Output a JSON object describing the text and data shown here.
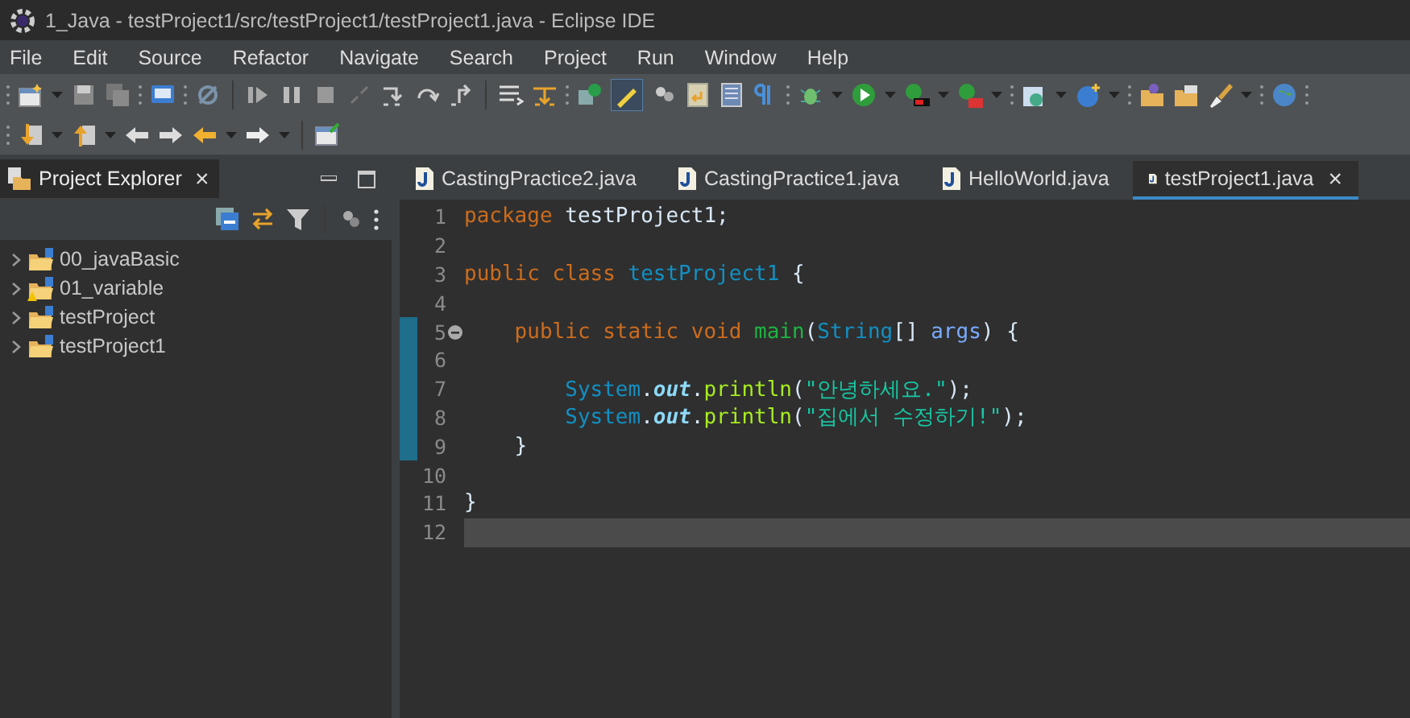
{
  "window": {
    "title": "1_Java - testProject1/src/testProject1/testProject1.java - Eclipse IDE"
  },
  "menu": [
    "File",
    "Edit",
    "Source",
    "Refactor",
    "Navigate",
    "Search",
    "Project",
    "Run",
    "Window",
    "Help"
  ],
  "explorer": {
    "title": "Project Explorer",
    "close": "×",
    "items": [
      {
        "name": "00_javaBasic",
        "expanded": false,
        "warning": false
      },
      {
        "name": "01_variable",
        "expanded": false,
        "warning": true
      },
      {
        "name": "testProject",
        "expanded": false,
        "warning": false
      },
      {
        "name": "testProject1",
        "expanded": false,
        "warning": false
      }
    ]
  },
  "editor": {
    "tabs": [
      {
        "label": "CastingPractice2.java",
        "selected": false
      },
      {
        "label": "CastingPractice1.java",
        "selected": false
      },
      {
        "label": "HelloWorld.java",
        "selected": false
      },
      {
        "label": "testProject1.java",
        "selected": true,
        "close": "×"
      }
    ],
    "lines": [
      {
        "number": "1",
        "changed": false,
        "foldable": false,
        "current": false,
        "tokens": [
          {
            "kind": "keyword",
            "text": "package "
          },
          {
            "kind": "plain",
            "text": "testProject1;"
          }
        ]
      },
      {
        "number": "2",
        "changed": false,
        "foldable": false,
        "current": false
      },
      {
        "number": "3",
        "changed": false,
        "foldable": false,
        "current": false,
        "tokens": [
          {
            "kind": "keyword",
            "text": "public class "
          },
          {
            "kind": "type",
            "text": "testProject1"
          },
          {
            "kind": "plain",
            "text": " {"
          }
        ]
      },
      {
        "number": "4",
        "changed": false,
        "foldable": false,
        "current": false
      },
      {
        "number": "5",
        "changed": true,
        "foldable": true,
        "current": false,
        "tokens": [
          {
            "kind": "keyword",
            "text": "    public static void "
          },
          {
            "kind": "method",
            "text": "main"
          },
          {
            "kind": "plain",
            "text": "("
          },
          {
            "kind": "type",
            "text": "String"
          },
          {
            "kind": "plain",
            "text": "[] "
          },
          {
            "kind": "param",
            "text": "args"
          },
          {
            "kind": "plain",
            "text": ") {"
          }
        ]
      },
      {
        "number": "6",
        "changed": true,
        "foldable": false,
        "current": false
      },
      {
        "number": "7",
        "changed": true,
        "foldable": false,
        "current": false,
        "tokens": [
          {
            "kind": "type",
            "text": "        System"
          },
          {
            "kind": "plain",
            "text": "."
          },
          {
            "kind": "field",
            "text": "out"
          },
          {
            "kind": "plain",
            "text": "."
          },
          {
            "kind": "call",
            "text": "println"
          },
          {
            "kind": "plain",
            "text": "("
          },
          {
            "kind": "string",
            "text": "\"안녕하세요.\""
          },
          {
            "kind": "plain",
            "text": ");"
          }
        ]
      },
      {
        "number": "8",
        "changed": true,
        "foldable": false,
        "current": false,
        "tokens": [
          {
            "kind": "type",
            "text": "        System"
          },
          {
            "kind": "plain",
            "text": "."
          },
          {
            "kind": "field",
            "text": "out"
          },
          {
            "kind": "plain",
            "text": "."
          },
          {
            "kind": "call",
            "text": "println"
          },
          {
            "kind": "plain",
            "text": "("
          },
          {
            "kind": "string",
            "text": "\"집에서 수정하기!\""
          },
          {
            "kind": "plain",
            "text": ");"
          }
        ]
      },
      {
        "number": "9",
        "changed": true,
        "foldable": false,
        "current": false,
        "tokens": [
          {
            "kind": "plain",
            "text": "    }"
          }
        ]
      },
      {
        "number": "10",
        "changed": false,
        "foldable": false,
        "current": false
      },
      {
        "number": "11",
        "changed": false,
        "foldable": false,
        "current": false,
        "tokens": [
          {
            "kind": "plain",
            "text": "}"
          }
        ]
      },
      {
        "number": "12",
        "changed": false,
        "foldable": false,
        "current": true
      }
    ]
  }
}
